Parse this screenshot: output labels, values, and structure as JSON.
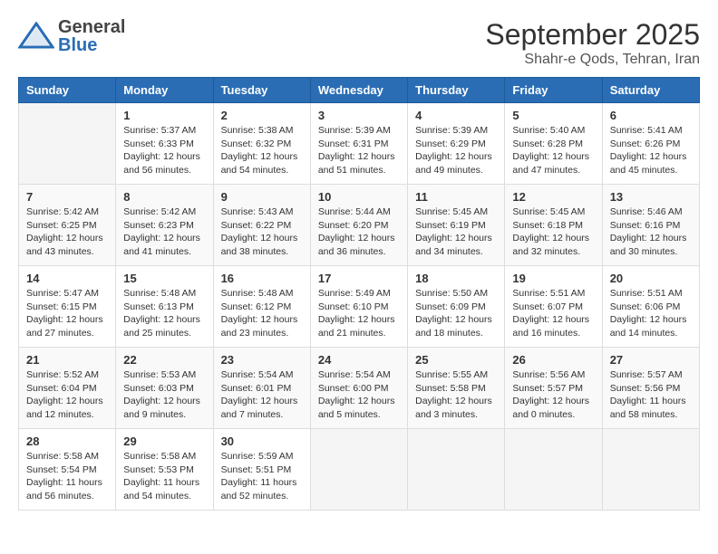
{
  "header": {
    "logo_line1": "General",
    "logo_line2": "Blue",
    "month": "September 2025",
    "location": "Shahr-e Qods, Tehran, Iran"
  },
  "days_of_week": [
    "Sunday",
    "Monday",
    "Tuesday",
    "Wednesday",
    "Thursday",
    "Friday",
    "Saturday"
  ],
  "weeks": [
    [
      {
        "day": "",
        "info": ""
      },
      {
        "day": "1",
        "info": "Sunrise: 5:37 AM\nSunset: 6:33 PM\nDaylight: 12 hours\nand 56 minutes."
      },
      {
        "day": "2",
        "info": "Sunrise: 5:38 AM\nSunset: 6:32 PM\nDaylight: 12 hours\nand 54 minutes."
      },
      {
        "day": "3",
        "info": "Sunrise: 5:39 AM\nSunset: 6:31 PM\nDaylight: 12 hours\nand 51 minutes."
      },
      {
        "day": "4",
        "info": "Sunrise: 5:39 AM\nSunset: 6:29 PM\nDaylight: 12 hours\nand 49 minutes."
      },
      {
        "day": "5",
        "info": "Sunrise: 5:40 AM\nSunset: 6:28 PM\nDaylight: 12 hours\nand 47 minutes."
      },
      {
        "day": "6",
        "info": "Sunrise: 5:41 AM\nSunset: 6:26 PM\nDaylight: 12 hours\nand 45 minutes."
      }
    ],
    [
      {
        "day": "7",
        "info": "Sunrise: 5:42 AM\nSunset: 6:25 PM\nDaylight: 12 hours\nand 43 minutes."
      },
      {
        "day": "8",
        "info": "Sunrise: 5:42 AM\nSunset: 6:23 PM\nDaylight: 12 hours\nand 41 minutes."
      },
      {
        "day": "9",
        "info": "Sunrise: 5:43 AM\nSunset: 6:22 PM\nDaylight: 12 hours\nand 38 minutes."
      },
      {
        "day": "10",
        "info": "Sunrise: 5:44 AM\nSunset: 6:20 PM\nDaylight: 12 hours\nand 36 minutes."
      },
      {
        "day": "11",
        "info": "Sunrise: 5:45 AM\nSunset: 6:19 PM\nDaylight: 12 hours\nand 34 minutes."
      },
      {
        "day": "12",
        "info": "Sunrise: 5:45 AM\nSunset: 6:18 PM\nDaylight: 12 hours\nand 32 minutes."
      },
      {
        "day": "13",
        "info": "Sunrise: 5:46 AM\nSunset: 6:16 PM\nDaylight: 12 hours\nand 30 minutes."
      }
    ],
    [
      {
        "day": "14",
        "info": "Sunrise: 5:47 AM\nSunset: 6:15 PM\nDaylight: 12 hours\nand 27 minutes."
      },
      {
        "day": "15",
        "info": "Sunrise: 5:48 AM\nSunset: 6:13 PM\nDaylight: 12 hours\nand 25 minutes."
      },
      {
        "day": "16",
        "info": "Sunrise: 5:48 AM\nSunset: 6:12 PM\nDaylight: 12 hours\nand 23 minutes."
      },
      {
        "day": "17",
        "info": "Sunrise: 5:49 AM\nSunset: 6:10 PM\nDaylight: 12 hours\nand 21 minutes."
      },
      {
        "day": "18",
        "info": "Sunrise: 5:50 AM\nSunset: 6:09 PM\nDaylight: 12 hours\nand 18 minutes."
      },
      {
        "day": "19",
        "info": "Sunrise: 5:51 AM\nSunset: 6:07 PM\nDaylight: 12 hours\nand 16 minutes."
      },
      {
        "day": "20",
        "info": "Sunrise: 5:51 AM\nSunset: 6:06 PM\nDaylight: 12 hours\nand 14 minutes."
      }
    ],
    [
      {
        "day": "21",
        "info": "Sunrise: 5:52 AM\nSunset: 6:04 PM\nDaylight: 12 hours\nand 12 minutes."
      },
      {
        "day": "22",
        "info": "Sunrise: 5:53 AM\nSunset: 6:03 PM\nDaylight: 12 hours\nand 9 minutes."
      },
      {
        "day": "23",
        "info": "Sunrise: 5:54 AM\nSunset: 6:01 PM\nDaylight: 12 hours\nand 7 minutes."
      },
      {
        "day": "24",
        "info": "Sunrise: 5:54 AM\nSunset: 6:00 PM\nDaylight: 12 hours\nand 5 minutes."
      },
      {
        "day": "25",
        "info": "Sunrise: 5:55 AM\nSunset: 5:58 PM\nDaylight: 12 hours\nand 3 minutes."
      },
      {
        "day": "26",
        "info": "Sunrise: 5:56 AM\nSunset: 5:57 PM\nDaylight: 12 hours\nand 0 minutes."
      },
      {
        "day": "27",
        "info": "Sunrise: 5:57 AM\nSunset: 5:56 PM\nDaylight: 11 hours\nand 58 minutes."
      }
    ],
    [
      {
        "day": "28",
        "info": "Sunrise: 5:58 AM\nSunset: 5:54 PM\nDaylight: 11 hours\nand 56 minutes."
      },
      {
        "day": "29",
        "info": "Sunrise: 5:58 AM\nSunset: 5:53 PM\nDaylight: 11 hours\nand 54 minutes."
      },
      {
        "day": "30",
        "info": "Sunrise: 5:59 AM\nSunset: 5:51 PM\nDaylight: 11 hours\nand 52 minutes."
      },
      {
        "day": "",
        "info": ""
      },
      {
        "day": "",
        "info": ""
      },
      {
        "day": "",
        "info": ""
      },
      {
        "day": "",
        "info": ""
      }
    ]
  ]
}
